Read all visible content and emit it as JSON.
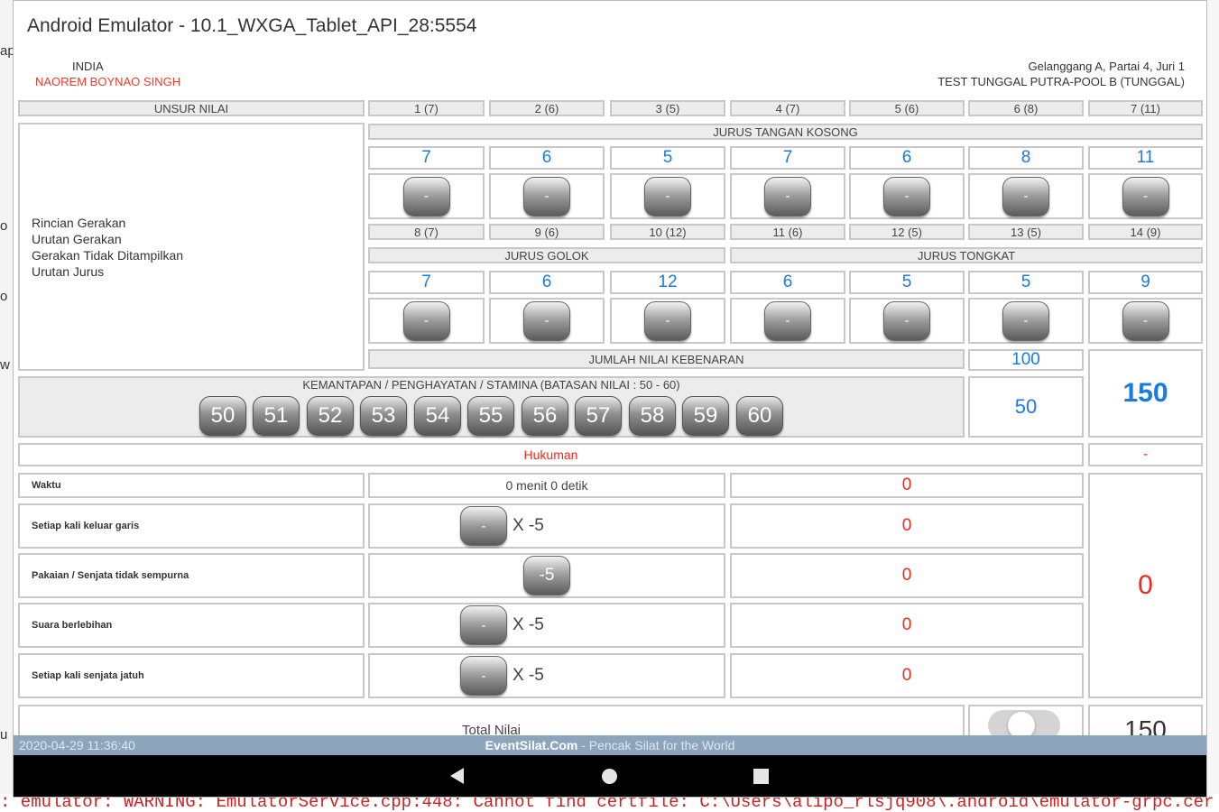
{
  "window": {
    "title": "Android Emulator - 10.1_WXGA_Tablet_API_28:5554"
  },
  "athlete": {
    "country": "INDIA",
    "name": "NAOREM BOYNAO SINGH"
  },
  "match": {
    "line1": "Gelanggang A, Partai 4, Juri 1",
    "line2": "TEST TUNGGAL PUTRA-POOL B (TUNGGAL)"
  },
  "table": {
    "unsur_label": "UNSUR NILAI",
    "detail_lines": [
      "Rincian Gerakan",
      "Urutan Gerakan",
      "Gerakan Tidak Ditampilkan",
      "Urutan Jurus"
    ],
    "jurus_tangan_kosong": {
      "title": "JURUS TANGAN KOSONG",
      "headers": [
        "1 (7)",
        "2 (6)",
        "3 (5)",
        "4 (7)",
        "5 (6)",
        "6 (8)",
        "7 (11)"
      ],
      "values": [
        "7",
        "6",
        "5",
        "7",
        "6",
        "8",
        "11"
      ]
    },
    "row2_headers": [
      "8 (7)",
      "9 (6)",
      "10 (12)",
      "11 (6)",
      "12 (5)",
      "13 (5)",
      "14 (9)"
    ],
    "jurus_golok_title": "JURUS GOLOK",
    "jurus_tongkat_title": "JURUS TONGKAT",
    "row2_values": [
      "7",
      "6",
      "12",
      "6",
      "5",
      "5",
      "9"
    ],
    "minus_label": "-",
    "jumlah_label": "JUMLAH NILAI KEBENARAN",
    "jumlah_value": "100",
    "kemantapan_label": "KEMANTAPAN / PENGHAYATAN / STAMINA (BATASAN NILAI : 50 - 60)",
    "kemantapan_options": [
      "50",
      "51",
      "52",
      "53",
      "54",
      "55",
      "56",
      "57",
      "58",
      "59",
      "60"
    ],
    "kemantapan_value": "50",
    "subtotal": "150",
    "hukuman_label": "Hukuman",
    "hukuman_dash": "-",
    "penalties": [
      {
        "label": "Waktu",
        "control": "0 menit 0 detik",
        "value": "0"
      },
      {
        "label": "Setiap kali keluar garis",
        "btn": "-",
        "mult": "X -5",
        "value": "0"
      },
      {
        "label": "Pakaian / Senjata tidak sempurna",
        "btn": "-5",
        "mult": "",
        "value": "0"
      },
      {
        "label": "Suara berlebihan",
        "btn": "-",
        "mult": "X -5",
        "value": "0"
      },
      {
        "label": "Setiap kali senjata jatuh",
        "btn": "-",
        "mult": "X -5",
        "value": "0"
      }
    ],
    "hukuman_total": "0",
    "total_label": "Total Nilai",
    "total_value": "150"
  },
  "footer": {
    "timestamp": "2020-04-29 11:36:40",
    "brand": "EventSilat.Com",
    "tagline": " - Pencak Silat for the World"
  },
  "console": {
    "text": ": emulator: WARNING: EmulatorService.cpp:448: Cannot find certfile: C:\\Users\\alipo_rlsjq908\\.android\\emulator-grpc.cer security will"
  },
  "desktop_fragments": [
    "ap",
    "o",
    "o",
    "w",
    "u"
  ],
  "colors": {
    "red": "#ee2a1a",
    "blue": "#1a7be0",
    "footer": "#8da4bd"
  }
}
